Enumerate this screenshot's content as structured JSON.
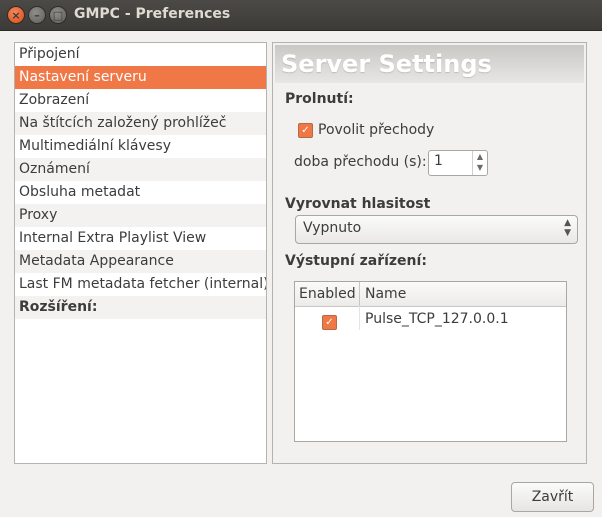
{
  "window": {
    "title": "GMPC - Preferences"
  },
  "sidebar": {
    "items": [
      {
        "label": "Připojení"
      },
      {
        "label": "Nastavení serveru"
      },
      {
        "label": "Zobrazení"
      },
      {
        "label": "Na štítcích založený prohlížeč"
      },
      {
        "label": "Multimediální klávesy"
      },
      {
        "label": "Oznámení"
      },
      {
        "label": "Obsluha metadat"
      },
      {
        "label": "Proxy"
      },
      {
        "label": "Internal Extra Playlist View"
      },
      {
        "label": "Metadata Appearance"
      },
      {
        "label": "Last FM metadata fetcher (internal)"
      },
      {
        "label": "Rozšíření:"
      }
    ]
  },
  "panel": {
    "header": "Server Settings",
    "crossfade_section": "Prolnutí:",
    "enable_crossfade_label": "Povolit přechody",
    "crossfade_duration_label": "doba přechodu (s):",
    "crossfade_duration_value": "1",
    "replaygain_section": "Vyrovnat hlasitost",
    "replaygain_value": "Vypnuto",
    "outputs_section": "Výstupní zařízení:",
    "table": {
      "columns": [
        "Enabled",
        "Name"
      ],
      "rows": [
        {
          "enabled": true,
          "name": "Pulse_TCP_127.0.0.1"
        }
      ]
    }
  },
  "footer": {
    "close_label": "Zavřít"
  },
  "colors": {
    "accent": "#f07746",
    "titlebar": "#3c3b37"
  }
}
